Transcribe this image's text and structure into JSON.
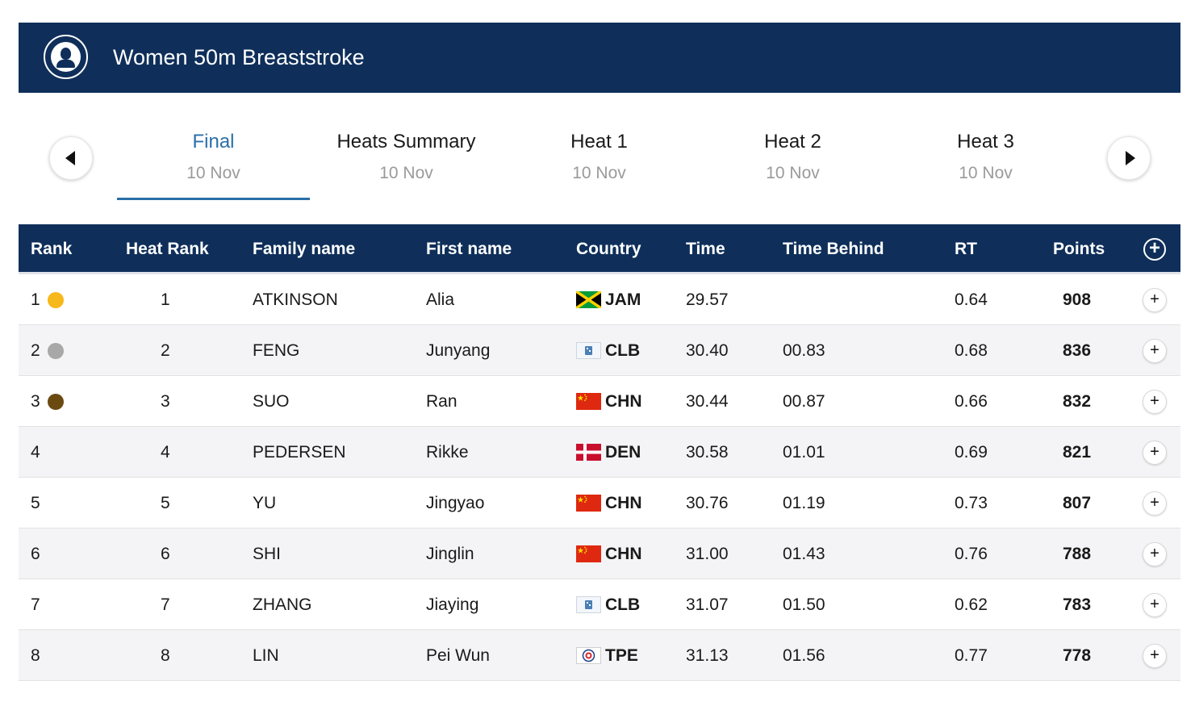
{
  "header": {
    "title": "Women 50m Breaststroke",
    "icon": "swimmer-avatar-icon",
    "colors": {
      "primary": "#0f2f5a",
      "accent": "#2a6fa8"
    }
  },
  "tabs": [
    {
      "name": "Final",
      "date": "10 Nov",
      "active": true
    },
    {
      "name": "Heats Summary",
      "date": "10 Nov",
      "active": false
    },
    {
      "name": "Heat 1",
      "date": "10 Nov",
      "active": false
    },
    {
      "name": "Heat 2",
      "date": "10 Nov",
      "active": false
    },
    {
      "name": "Heat 3",
      "date": "10 Nov",
      "active": false
    }
  ],
  "table": {
    "columns": [
      "Rank",
      "Heat Rank",
      "Family name",
      "First name",
      "Country",
      "Time",
      "Time Behind",
      "RT",
      "Points"
    ],
    "rows": [
      {
        "rank": "1",
        "medal": "gold",
        "medal_color": "#f7b81c",
        "heat_rank": "1",
        "family": "ATKINSON",
        "first": "Alia",
        "flag": "jamaica-flag-icon",
        "country": "JAM",
        "time": "29.57",
        "behind": "",
        "rt": "0.64",
        "points": "908"
      },
      {
        "rank": "2",
        "medal": "silver",
        "medal_color": "#a8a8a8",
        "heat_rank": "2",
        "family": "FENG",
        "first": "Junyang",
        "flag": "club-flag-icon",
        "country": "CLB",
        "time": "30.40",
        "behind": "00.83",
        "rt": "0.68",
        "points": "836"
      },
      {
        "rank": "3",
        "medal": "bronze",
        "medal_color": "#6b4a12",
        "heat_rank": "3",
        "family": "SUO",
        "first": "Ran",
        "flag": "china-flag-icon",
        "country": "CHN",
        "time": "30.44",
        "behind": "00.87",
        "rt": "0.66",
        "points": "832"
      },
      {
        "rank": "4",
        "medal": "",
        "medal_color": "",
        "heat_rank": "4",
        "family": "PEDERSEN",
        "first": "Rikke",
        "flag": "denmark-flag-icon",
        "country": "DEN",
        "time": "30.58",
        "behind": "01.01",
        "rt": "0.69",
        "points": "821"
      },
      {
        "rank": "5",
        "medal": "",
        "medal_color": "",
        "heat_rank": "5",
        "family": "YU",
        "first": "Jingyao",
        "flag": "china-flag-icon",
        "country": "CHN",
        "time": "30.76",
        "behind": "01.19",
        "rt": "0.73",
        "points": "807"
      },
      {
        "rank": "6",
        "medal": "",
        "medal_color": "",
        "heat_rank": "6",
        "family": "SHI",
        "first": "Jinglin",
        "flag": "china-flag-icon",
        "country": "CHN",
        "time": "31.00",
        "behind": "01.43",
        "rt": "0.76",
        "points": "788"
      },
      {
        "rank": "7",
        "medal": "",
        "medal_color": "",
        "heat_rank": "7",
        "family": "ZHANG",
        "first": "Jiaying",
        "flag": "club-flag-icon",
        "country": "CLB",
        "time": "31.07",
        "behind": "01.50",
        "rt": "0.62",
        "points": "783"
      },
      {
        "rank": "8",
        "medal": "",
        "medal_color": "",
        "heat_rank": "8",
        "family": "LIN",
        "first": "Pei Wun",
        "flag": "chinese-taipei-flag-icon",
        "country": "TPE",
        "time": "31.13",
        "behind": "01.56",
        "rt": "0.77",
        "points": "778"
      }
    ]
  }
}
